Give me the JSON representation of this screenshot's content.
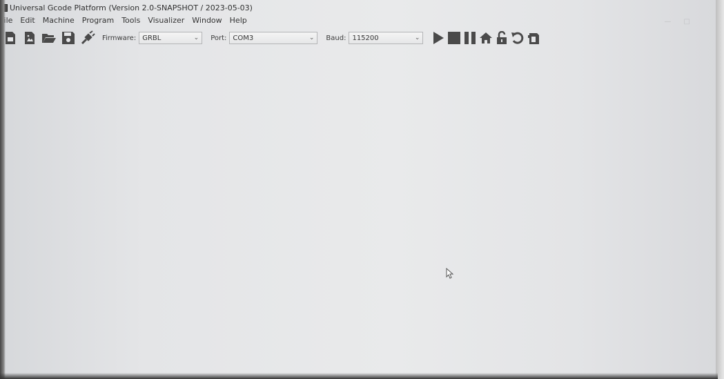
{
  "window": {
    "title": "Universal Gcode Platform (Version 2.0-SNAPSHOT / 2023-05-03)"
  },
  "menu": {
    "items": [
      "File",
      "Edit",
      "Machine",
      "Program",
      "Tools",
      "Visualizer",
      "Window",
      "Help"
    ]
  },
  "toolbar": {
    "firmware_label": "Firmware:",
    "firmware_value": "GRBL",
    "port_label": "Port:",
    "port_value": "COM3",
    "baud_label": "Baud:",
    "baud_value": "115200"
  },
  "icons": {
    "file_actions": [
      "new-file-icon",
      "open-image-icon",
      "open-folder-icon",
      "save-icon",
      "connect-plug-icon"
    ],
    "controls": [
      "play-icon",
      "stop-icon",
      "pause-icon",
      "home-icon",
      "unlock-icon",
      "reset-icon",
      "soft-reset-icon"
    ]
  },
  "colors": {
    "icon": "#4a4a4a",
    "background": "#e6e7e9"
  }
}
